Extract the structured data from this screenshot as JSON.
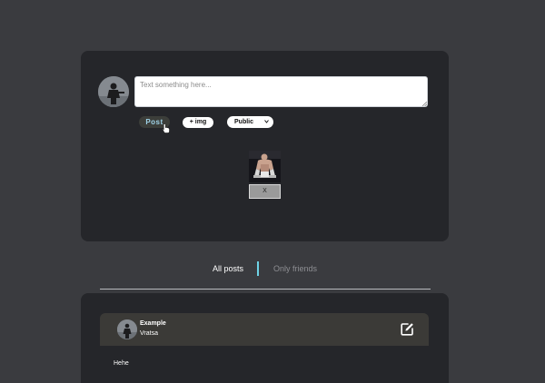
{
  "composer": {
    "input_placeholder": "Text something here...",
    "input_value": "",
    "post_label": "Post",
    "add_image_label": "+ img",
    "visibility_selected": "Public",
    "remove_image_label": "X"
  },
  "tabs": {
    "all_posts": "All posts",
    "only_friends": "Only friends",
    "active": "All posts"
  },
  "feed": {
    "posts": [
      {
        "author": "Example",
        "location": "Vratsa",
        "body": "Hehe"
      }
    ]
  },
  "colors": {
    "page_background": "#3a3b3f",
    "card_background": "#25262a",
    "accent": "#6ed3e6",
    "post_header_background": "#3b3a37"
  },
  "icons": {
    "cursor": "hand-pointer-icon",
    "dropdown": "chevron-down-icon",
    "edit": "edit-square-icon"
  }
}
